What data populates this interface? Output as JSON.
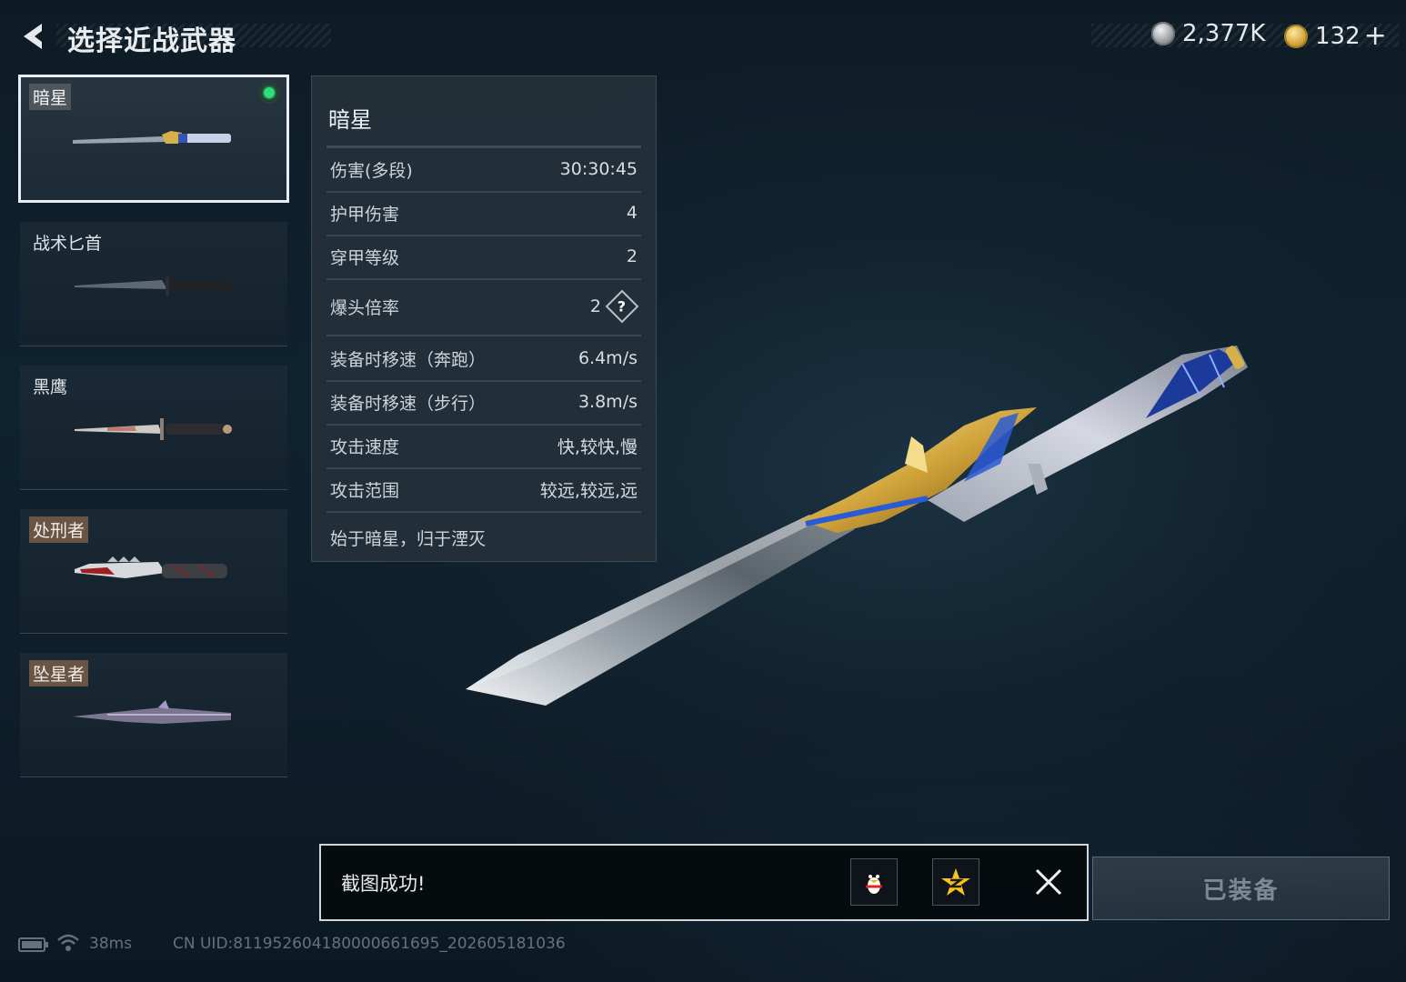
{
  "header": {
    "title": "选择近战武器",
    "back_icon": "chevron-left-icon"
  },
  "currency": {
    "silver_amount": "2,377K",
    "gold_amount": "132",
    "add_symbol": "+"
  },
  "weapons": [
    {
      "name": "暗星",
      "selected": true,
      "equipped": true
    },
    {
      "name": "战术匕首",
      "selected": false,
      "equipped": false
    },
    {
      "name": "黑鹰",
      "selected": false,
      "equipped": false
    },
    {
      "name": "处刑者",
      "selected": false,
      "equipped": false
    },
    {
      "name": "坠星者",
      "selected": false,
      "equipped": false
    }
  ],
  "stats": {
    "title": "暗星",
    "rows": [
      {
        "label": "伤害(多段)",
        "value": "30:30:45"
      },
      {
        "label": "护甲伤害",
        "value": "4"
      },
      {
        "label": "穿甲等级",
        "value": "2"
      },
      {
        "label": "爆头倍率",
        "value": "2",
        "help": "?"
      },
      {
        "label": "装备时移速（奔跑）",
        "value": "6.4m/s"
      },
      {
        "label": "装备时移速（步行）",
        "value": "3.8m/s"
      },
      {
        "label": "攻击速度",
        "value": "快,较快,慢"
      },
      {
        "label": "攻击范围",
        "value": "较远,较远,远"
      }
    ],
    "description": "始于暗星，归于湮灭"
  },
  "toast": {
    "message": "截图成功!"
  },
  "equip_button": {
    "label": "已装备"
  },
  "status_bar": {
    "ping": "38ms",
    "uid": "CN UID:811952604180000661695_202605181036"
  },
  "colors": {
    "accent_green": "#2bde7a",
    "tag_brown": "#6a5545",
    "gold": "#d3a43b",
    "blue": "#2a5bd6"
  }
}
